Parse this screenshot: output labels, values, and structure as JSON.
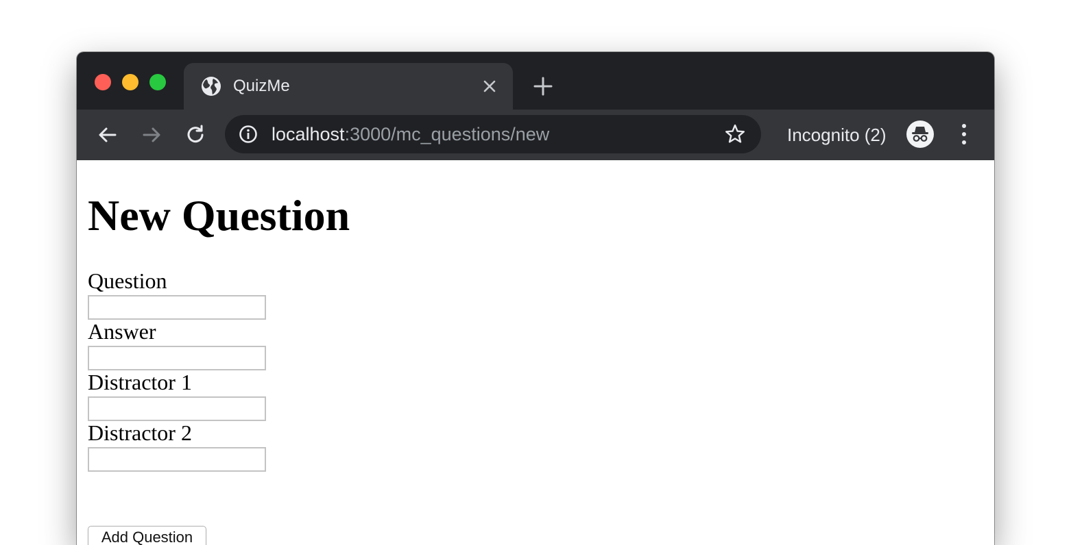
{
  "browser": {
    "tab": {
      "title": "QuizMe",
      "favicon": "globe-icon"
    },
    "address_bar": {
      "host": "localhost",
      "path": ":3000/mc_questions/new"
    },
    "profile": {
      "label": "Incognito (2)",
      "icon": "incognito-icon"
    },
    "colors": {
      "frame": "#202124",
      "toolbar": "#35363a",
      "omnibox": "#202124",
      "text": "#e8eaed",
      "muted_text": "#9aa0a6"
    }
  },
  "page": {
    "title": "New Question",
    "form": {
      "fields": [
        {
          "label": "Question",
          "value": ""
        },
        {
          "label": "Answer",
          "value": ""
        },
        {
          "label": "Distractor 1",
          "value": ""
        },
        {
          "label": "Distractor 2",
          "value": ""
        }
      ],
      "submit_label": "Add Question"
    }
  }
}
